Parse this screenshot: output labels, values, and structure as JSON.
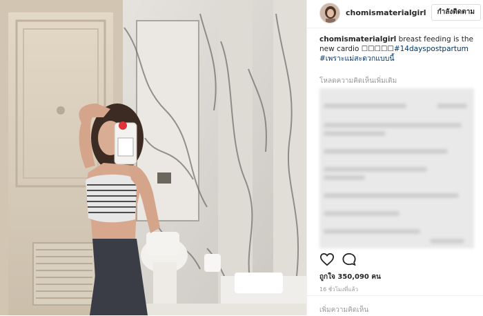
{
  "post": {
    "username": "chomismaterialgirl",
    "follow_label": "กำลังติดตาม",
    "caption_text": " breast feeding is the new cardio ",
    "caption_emoji": "☐☐☐☐☐",
    "hashtag1": "#14dayspostpartum",
    "hashtag2": "#เพราะแม่สะดวกแบบนี้",
    "load_more_comments": "โหลดความคิดเห็นเพิ่มเติม",
    "likes": "ถูกใจ 350,090 คน",
    "time_ago": "16 ชั่วโมงที่แล้ว",
    "add_comment_placeholder": "เพิ่มความคิดเห็น"
  },
  "icons": {
    "like": "heart-outline-icon",
    "comment": "comment-bubble-icon"
  },
  "colors": {
    "text": "#262626",
    "muted": "#999999",
    "hashtag": "#003569",
    "border": "#efefef"
  }
}
